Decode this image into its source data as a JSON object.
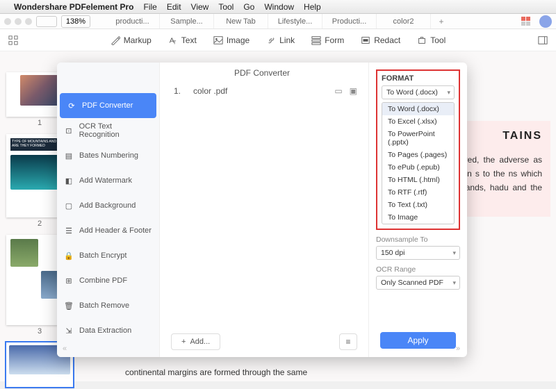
{
  "menubar": {
    "app": "Wondershare PDFelement Pro",
    "items": [
      "File",
      "Edit",
      "View",
      "Tool",
      "Go",
      "Window",
      "Help"
    ]
  },
  "toprow": {
    "zoom": "138%",
    "tabs": [
      "producti...",
      "Sample...",
      "New Tab",
      "Lifestyle...",
      "Producti...",
      "color2"
    ],
    "active_tab": 3
  },
  "tools": {
    "markup": "Markup",
    "text": "Text",
    "image": "Image",
    "link": "Link",
    "form": "Form",
    "redact": "Redact",
    "tool": "Tool"
  },
  "thumbs": {
    "page2_bar": "TYPE OF MOUNTAINS AND HOW ARE THEY FORMED",
    "nums": [
      "1",
      "2",
      "3"
    ]
  },
  "doc": {
    "title_fragment": "TAINS",
    "body": "created fted area. urred, the adverse as wind turn can rosion in s to the ns which ountains residual ighlands, hadu and the Snowdonia in Wales.",
    "below": "continental margins are formed through the same"
  },
  "modal": {
    "title": "PDF Converter",
    "sidebar": [
      "PDF Converter",
      "OCR Text Recognition",
      "Bates Numbering",
      "Add Watermark",
      "Add Background",
      "Add Header & Footer",
      "Batch Encrypt",
      "Combine PDF",
      "Batch Remove",
      "Data Extraction"
    ],
    "active_sidebar": 0,
    "file": {
      "num": "1.",
      "name": "color .pdf"
    },
    "add": "Add...",
    "format": {
      "label": "FORMAT",
      "selected": "To Word (.docx)",
      "options": [
        "To Word (.docx)",
        "To Excel (.xlsx)",
        "To PowerPoint (.pptx)",
        "To Pages (.pages)",
        "To ePub (.epub)",
        "To HTML (.html)",
        "To RTF (.rtf)",
        "To Text (.txt)",
        "To Image"
      ]
    },
    "downsample": {
      "label": "Downsample To",
      "value": "150 dpi"
    },
    "ocr": {
      "label": "OCR Range",
      "value": "Only Scanned PDF"
    },
    "apply": "Apply"
  }
}
